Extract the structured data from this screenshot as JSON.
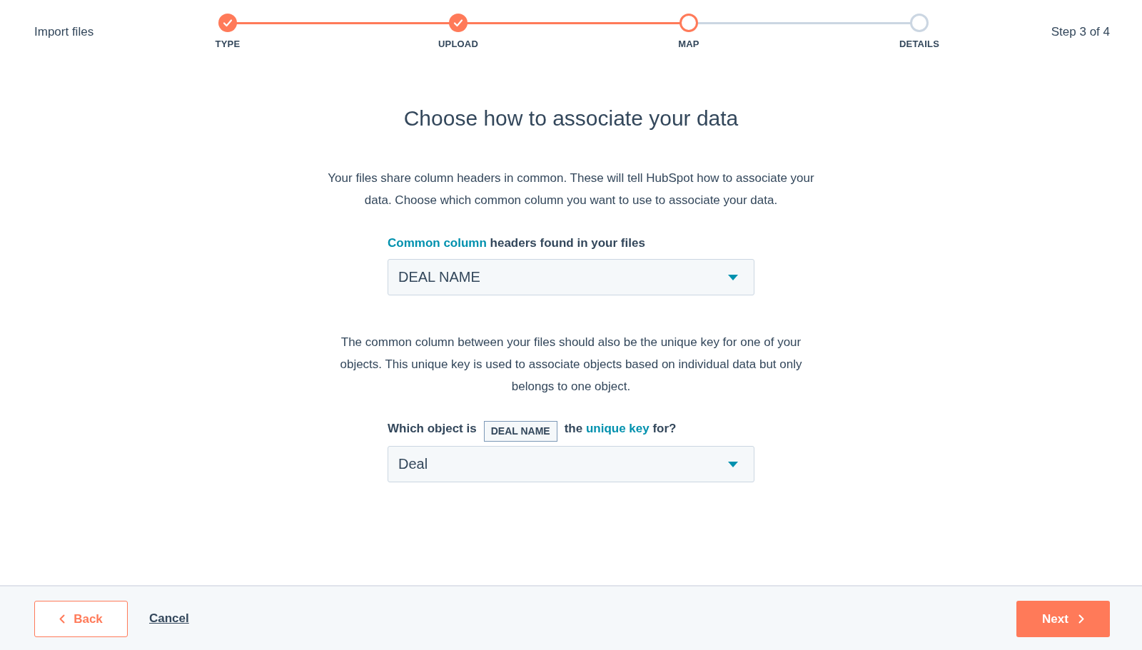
{
  "header": {
    "title": "Import files",
    "step_counter": "Step 3 of 4"
  },
  "steps": [
    {
      "label": "TYPE",
      "kind": "completed"
    },
    {
      "label": "UPLOAD",
      "kind": "completed"
    },
    {
      "label": "MAP",
      "kind": "current"
    },
    {
      "label": "DETAILS",
      "kind": "upcoming"
    }
  ],
  "heading": "Choose how to associate your data",
  "intro": "Your files share column headers in common. These will tell HubSpot how to associate your data. Choose which common column you want to use to associate your data.",
  "column_field": {
    "label_link": "Common column",
    "label_rest": "headers found in your files",
    "value": "DEAL NAME"
  },
  "explanation": "The common column between your files should also be the unique key for one of your objects. This unique key is used to associate objects based on individual data but only belongs to one object.",
  "object_field": {
    "label_before": "Which object is",
    "key_tag": "DEAL NAME",
    "label_middle": "the",
    "label_link": "unique key",
    "label_after": "for?",
    "value": "Deal"
  },
  "footer": {
    "back": "Back",
    "cancel": "Cancel",
    "next": "Next"
  }
}
